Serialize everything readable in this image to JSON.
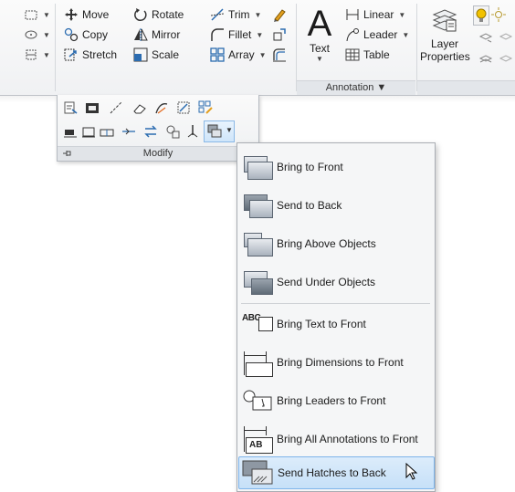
{
  "ribbon": {
    "modify_tools": [
      {
        "label": "Move",
        "icon": "move-icon"
      },
      {
        "label": "Rotate",
        "icon": "rotate-icon"
      },
      {
        "label": "Trim",
        "icon": "trim-icon"
      },
      {
        "label": "Copy",
        "icon": "copy-icon"
      },
      {
        "label": "Mirror",
        "icon": "mirror-icon"
      },
      {
        "label": "Fillet",
        "icon": "fillet-icon"
      },
      {
        "label": "Stretch",
        "icon": "stretch-icon"
      },
      {
        "label": "Scale",
        "icon": "scale-icon"
      },
      {
        "label": "Array",
        "icon": "array-icon"
      }
    ],
    "annotation": {
      "text_label": "Text",
      "text_glyph": "A",
      "linear_label": "Linear",
      "leader_label": "Leader",
      "table_label": "Table",
      "panel_title": "Annotation ▼"
    },
    "layers": {
      "layer_properties_line1": "Layer",
      "layer_properties_line2": "Properties"
    }
  },
  "modify_panel": {
    "title": "Modify",
    "draworder_button_icon": "draw-order-icon"
  },
  "draworder_menu": {
    "items": [
      {
        "label": "Bring to Front",
        "icon": "bring-to-front-icon"
      },
      {
        "label": "Send to Back",
        "icon": "send-to-back-icon"
      },
      {
        "label": "Bring Above Objects",
        "icon": "bring-above-objects-icon"
      },
      {
        "label": "Send Under Objects",
        "icon": "send-under-objects-icon"
      },
      {
        "label": "Bring Text to Front",
        "icon": "bring-text-to-front-icon",
        "icon_text": "ABC"
      },
      {
        "label": "Bring Dimensions to Front",
        "icon": "bring-dimensions-to-front-icon"
      },
      {
        "label": "Bring Leaders to Front",
        "icon": "bring-leaders-to-front-icon"
      },
      {
        "label": "Bring All Annotations to Front",
        "icon": "bring-all-annotations-to-front-icon",
        "icon_text": "AB"
      },
      {
        "label": "Send Hatches to Back",
        "icon": "send-hatches-to-back-icon"
      }
    ],
    "highlighted": "Send Hatches to Back"
  },
  "colors": {
    "highlight_bg": "#c6e0f8",
    "highlight_border": "#7eb4ea",
    "icon_blue": "#2b6cb0",
    "lightbulb": "#f2c200"
  }
}
